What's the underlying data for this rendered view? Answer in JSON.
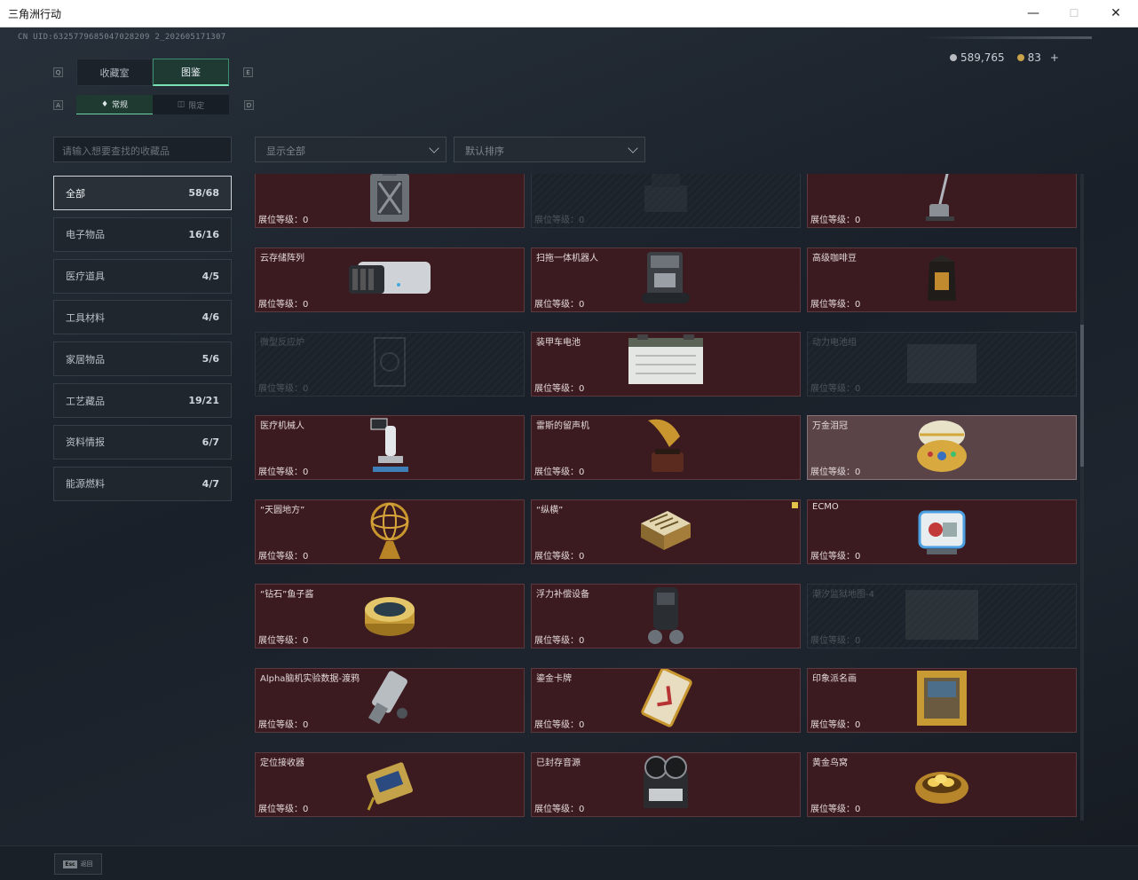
{
  "window": {
    "title": "三角洲行动",
    "min": "—",
    "max": "☐",
    "close": "✕"
  },
  "header": {
    "uid": "CN UID:6325779685047028209 2_202605171307",
    "currency1": "589,765",
    "currency2": "83",
    "plus": "+",
    "coin1_color": "#b8bcc0",
    "coin2_color": "#c9a24a"
  },
  "keys": {
    "q": "Q",
    "e": "E",
    "a": "A",
    "d": "D"
  },
  "tabs": [
    {
      "label": "收藏室"
    },
    {
      "label": "图鉴"
    }
  ],
  "subtabs": [
    {
      "label": "常规"
    },
    {
      "label": "限定"
    }
  ],
  "search": {
    "placeholder": "请输入想要查找的收藏品"
  },
  "filters": {
    "show": "显示全部",
    "sort": "默认排序"
  },
  "categories": [
    {
      "label": "全部",
      "count": "58/68"
    },
    {
      "label": "电子物品",
      "count": "16/16"
    },
    {
      "label": "医疗道具",
      "count": "4/5"
    },
    {
      "label": "工具材料",
      "count": "4/6"
    },
    {
      "label": "家居物品",
      "count": "5/6"
    },
    {
      "label": "工艺藏品",
      "count": "19/21"
    },
    {
      "label": "资料情报",
      "count": "6/7"
    },
    {
      "label": "能源燃料",
      "count": "4/7"
    }
  ],
  "level_label": "展位等级：0",
  "items": [
    {
      "name": "",
      "icon": "fuel-can-icon"
    },
    {
      "name": "",
      "icon": "machine-icon"
    },
    {
      "name": "",
      "icon": "vacuum-mop-icon"
    },
    {
      "name": "云存储阵列",
      "icon": "storage-array-icon"
    },
    {
      "name": "扫拖一体机器人",
      "icon": "robot-cleaner-icon"
    },
    {
      "name": "高级咖啡豆",
      "icon": "coffee-bag-icon"
    },
    {
      "name": "微型反应炉",
      "icon": "reactor-icon"
    },
    {
      "name": "装甲车电池",
      "icon": "battery-icon"
    },
    {
      "name": "动力电池组",
      "icon": "battery-pack-icon"
    },
    {
      "name": "医疗机械人",
      "icon": "medical-robot-icon"
    },
    {
      "name": "雷斯的留声机",
      "icon": "gramophone-icon"
    },
    {
      "name": "万金泪冠",
      "icon": "jeweled-egg-icon"
    },
    {
      "name": "“天圆地方”",
      "icon": "armillary-sphere-icon"
    },
    {
      "name": "“纵横”",
      "icon": "chess-box-icon"
    },
    {
      "name": "ECMO",
      "icon": "ecmo-machine-icon"
    },
    {
      "name": "“钻石”鱼子酱",
      "icon": "caviar-tin-icon"
    },
    {
      "name": "浮力补偿设备",
      "icon": "buoyancy-device-icon"
    },
    {
      "name": "潮汐监狱地图-4",
      "icon": "map-icon"
    },
    {
      "name": "Alpha脑机实验数据-渡鸦",
      "icon": "data-device-icon"
    },
    {
      "name": "鎏金卡牌",
      "icon": "gilded-card-icon"
    },
    {
      "name": "印象派名画",
      "icon": "painting-icon"
    },
    {
      "name": "定位接收器",
      "icon": "gps-receiver-icon"
    },
    {
      "name": "已封存音源",
      "icon": "tape-recorder-icon"
    },
    {
      "name": "黄金鸟窝",
      "icon": "golden-nest-icon"
    }
  ],
  "footer": {
    "esc_key": "Esc",
    "esc_label": "返回"
  }
}
